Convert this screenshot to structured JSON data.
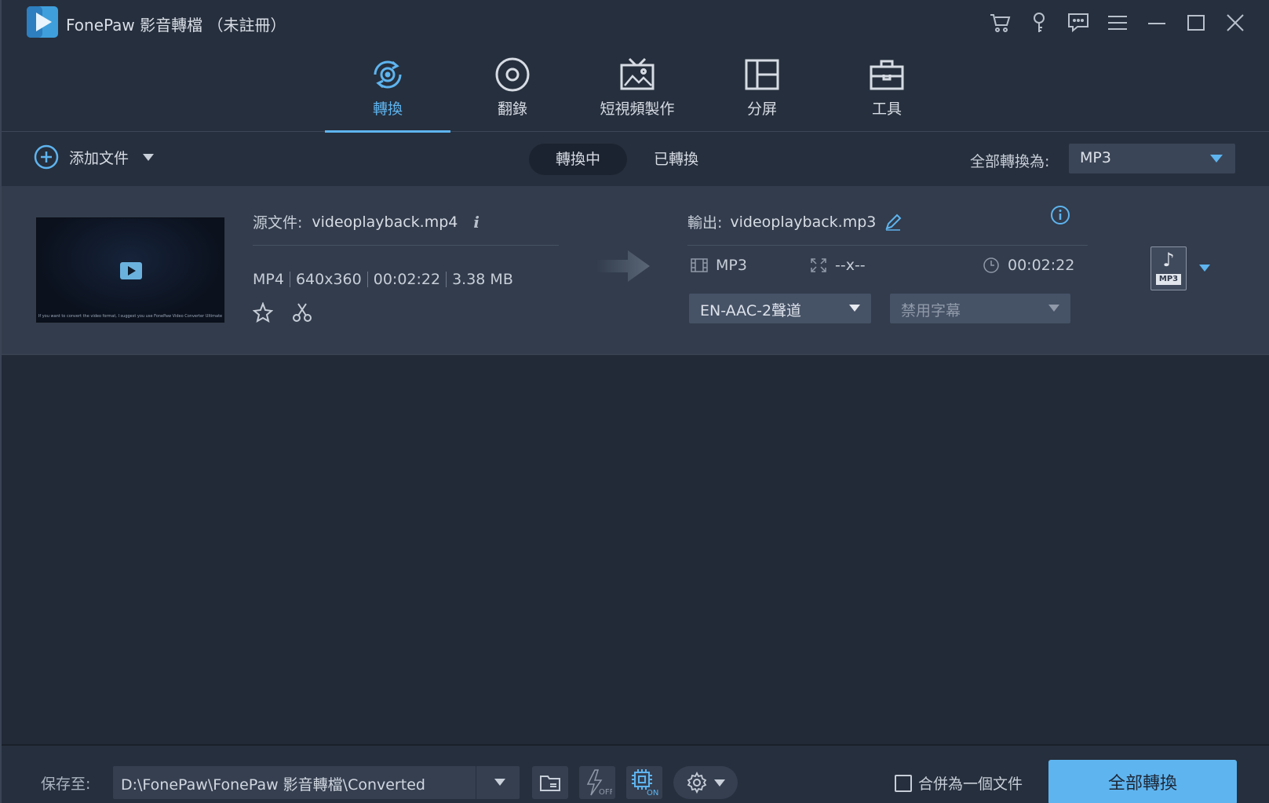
{
  "app": {
    "title": "FonePaw 影音轉檔 （未註冊）"
  },
  "titlebar_icons": [
    "cart-icon",
    "key-icon",
    "chat-icon",
    "menu-icon",
    "minimize-icon",
    "maximize-icon",
    "close-icon"
  ],
  "nav": {
    "items": [
      {
        "label": "轉換",
        "icon": "convert-icon",
        "active": true
      },
      {
        "label": "翻錄",
        "icon": "disc-icon",
        "active": false
      },
      {
        "label": "短視頻製作",
        "icon": "tv-image-icon",
        "active": false
      },
      {
        "label": "分屏",
        "icon": "split-screen-icon",
        "active": false
      },
      {
        "label": "工具",
        "icon": "toolbox-icon",
        "active": false
      }
    ]
  },
  "toolbar": {
    "add_file_label": "添加文件",
    "tabs": [
      {
        "label": "轉換中",
        "active": true
      },
      {
        "label": "已轉換",
        "active": false
      }
    ],
    "convert_all_to_label": "全部轉換為:",
    "convert_all_to_value": "MP3"
  },
  "file": {
    "thumbnail_caption": "If you want to convert the video format, I suggest you use FonePaw Video Converter Ultimate",
    "source_label": "源文件:",
    "source_name": "videoplayback.mp4",
    "format": "MP4",
    "resolution": "640x360",
    "duration": "00:02:22",
    "size": "3.38 MB",
    "output_label": "輸出:",
    "output_name": "videoplayback.mp3",
    "output_format": "MP3",
    "output_resolution": "--x--",
    "output_duration": "00:02:22",
    "audio_track": "EN-AAC-2聲道",
    "subtitle": "禁用字幕",
    "badge_label": "MP3"
  },
  "bottom": {
    "save_to_label": "保存至:",
    "path": "D:\\FonePaw\\FonePaw 影音轉檔\\Converted",
    "accel_off_label": "OFF",
    "gpu_on_label": "ON",
    "merge_label": "合併為一個文件",
    "convert_all_label": "全部轉換"
  },
  "colors": {
    "accent": "#5eb4ef",
    "background": "#262f3d",
    "item_background": "#323c4c"
  }
}
